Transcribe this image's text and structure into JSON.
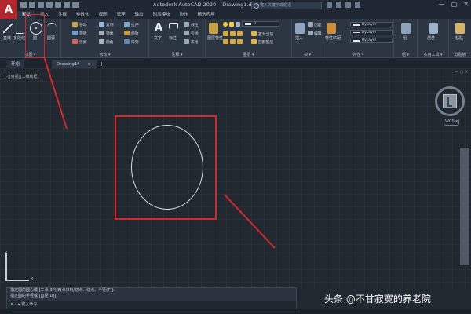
{
  "titlebar": {
    "app_letter": "A",
    "app_name": "Autodesk AutoCAD 2020",
    "file_name": "Drawing1.dwg",
    "search_placeholder": "键入关键字或短语",
    "minimize": "—",
    "maximize": "▢",
    "close": "✕"
  },
  "menu_tabs": [
    "默认",
    "插入",
    "注释",
    "参数化",
    "视图",
    "管理",
    "输出",
    "附加模块",
    "协作",
    "精选应用"
  ],
  "ribbon": {
    "draw_panel": {
      "title": "绘图 ▾",
      "line": "直线",
      "polyline": "多段线",
      "circle": "圆",
      "arc": "圆弧"
    },
    "modify_panel": {
      "title": "修改 ▾",
      "move": "移动",
      "rotate": "旋转",
      "trim": "修剪",
      "copy": "复制",
      "mirror": "镜像",
      "fillet": "圆角",
      "stretch": "拉伸",
      "scale": "缩放",
      "array": "阵列"
    },
    "annotation_panel": {
      "title": "注释 ▾",
      "text": "文字",
      "dimension": "标注",
      "linear": "线性",
      "leader": "引线",
      "table": "表格"
    },
    "layers_panel": {
      "title": "图层 ▾",
      "layer_props": "图层特性",
      "layer_value": "0",
      "make_current": "置为当前",
      "match_layer": "匹配图层"
    },
    "block_panel": {
      "title": "块 ▾",
      "insert": "插入",
      "create": "创建",
      "edit": "编辑"
    },
    "properties_panel": {
      "title": "特性 ▾",
      "match": "特性匹配",
      "color": "ByLayer",
      "linetype": "ByLayer",
      "lineweight": "ByLayer"
    },
    "groups_panel": {
      "title": "组 ▾",
      "group": "组"
    },
    "utilities_panel": {
      "title": "实用工具 ▾",
      "measure": "测量"
    },
    "clipboard_panel": {
      "title": "剪贴板",
      "paste": "粘贴"
    }
  },
  "doc_tabs": {
    "start": "开始",
    "drawing": "Drawing1*",
    "close": "×",
    "add": "+"
  },
  "viewport": {
    "label": "[-][俯视][二维线框]",
    "controls": "— ▢ ✕",
    "wcs": "WCS ▾",
    "ucs_y": "Y",
    "ucs_x": "X"
  },
  "command_line": {
    "history": [
      "指定圆的圆心或 [三点(3P)/两点(2P)/切点、切点、半径(T)]:",
      "指定圆的半径或 [直径(D)]:"
    ],
    "prompt": "✕ ⌕ ▸  键入命令"
  },
  "watermark": "头条 @不甘寂寞的养老院",
  "colors": {
    "annotation_red": "#d9262b",
    "logo_red": "#b3262b",
    "canvas": "#212830"
  }
}
